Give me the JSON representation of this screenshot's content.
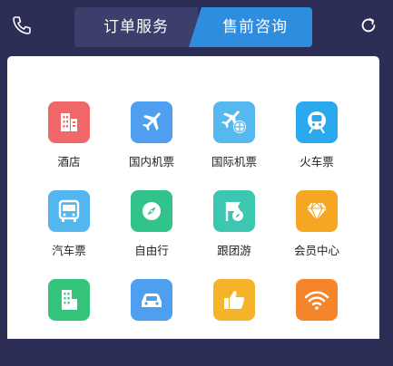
{
  "header": {
    "phone_icon": "phone-icon",
    "refresh_icon": "refresh-icon",
    "tabs": [
      {
        "label": "订单服务",
        "active": false
      },
      {
        "label": "售前咨询",
        "active": true
      }
    ]
  },
  "services": [
    {
      "label": "酒店",
      "icon": "hotel-icon",
      "color": "#f0686a"
    },
    {
      "label": "国内机票",
      "icon": "airplane-icon",
      "color": "#4f9ff0"
    },
    {
      "label": "国际机票",
      "icon": "intl-flight-icon",
      "color": "#55b8ee"
    },
    {
      "label": "火车票",
      "icon": "train-icon",
      "color": "#2aa9ee"
    },
    {
      "label": "汽车票",
      "icon": "bus-icon",
      "color": "#54b6ef"
    },
    {
      "label": "自由行",
      "icon": "compass-icon",
      "color": "#31c38a"
    },
    {
      "label": "跟团游",
      "icon": "flag-compass-icon",
      "color": "#3ec7b0"
    },
    {
      "label": "会员中心",
      "icon": "diamond-icon",
      "color": "#f5a623"
    },
    {
      "label": "",
      "icon": "building-icon",
      "color": "#34c47c"
    },
    {
      "label": "",
      "icon": "car-icon",
      "color": "#4f9ff0"
    },
    {
      "label": "",
      "icon": "thumbs-up-icon",
      "color": "#f5b329"
    },
    {
      "label": "",
      "icon": "wifi-icon",
      "color": "#f5852a"
    }
  ]
}
